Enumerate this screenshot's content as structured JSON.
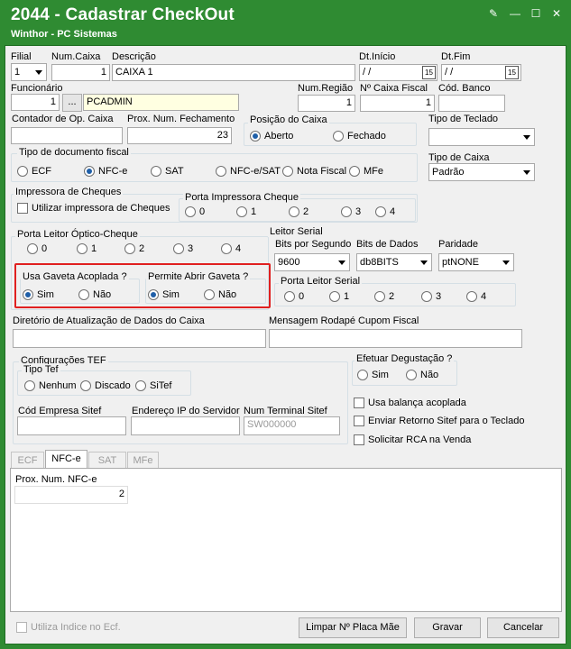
{
  "window": {
    "title": "2044 - Cadastrar CheckOut",
    "subtitle": "Winthor - PC Sistemas",
    "controls": {
      "edit": "✎",
      "minimize": "—",
      "maximize": "☐",
      "close": "✕"
    }
  },
  "fields": {
    "filial": {
      "label": "Filial",
      "value": "1"
    },
    "num_caixa": {
      "label": "Num.Caixa",
      "value": "1"
    },
    "descricao": {
      "label": "Descrição",
      "value": "CAIXA 1"
    },
    "dt_inicio": {
      "label": "Dt.Início",
      "value": " / /"
    },
    "dt_fim": {
      "label": "Dt.Fim",
      "value": " / /"
    },
    "calendar_glyph": "15",
    "funcionario": {
      "label": "Funcionário",
      "code": "1",
      "lookup": "...",
      "name": "PCADMIN"
    },
    "num_regiao": {
      "label": "Num.Região",
      "value": "1"
    },
    "num_caixa_fiscal": {
      "label": "Nº Caixa Fiscal",
      "value": "1"
    },
    "cod_banco": {
      "label": "Cód. Banco",
      "value": ""
    },
    "contador_op": {
      "label": "Contador de Op. Caixa",
      "value": ""
    },
    "prox_num_fechamento": {
      "label": "Prox. Num. Fechamento",
      "value": "23"
    },
    "tipo_teclado": {
      "label": "Tipo de Teclado",
      "value": ""
    },
    "tipo_caixa": {
      "label": "Tipo de Caixa",
      "value": "Padrão"
    },
    "diretorio": {
      "label": "Diretório de Atualização de Dados do Caixa",
      "value": ""
    },
    "mensagem_rodape": {
      "label": "Mensagem Rodapé Cupom Fiscal",
      "value": ""
    }
  },
  "posicao_caixa": {
    "title": "Posição do Caixa",
    "options": [
      "Aberto",
      "Fechado"
    ],
    "selected": "Aberto"
  },
  "tipo_documento": {
    "title": "Tipo de documento fiscal",
    "options": [
      "ECF",
      "NFC-e",
      "SAT",
      "NFC-e/SAT",
      "Nota Fiscal",
      "MFe"
    ],
    "selected": "NFC-e"
  },
  "impressora_cheques": {
    "title": "Impressora de Cheques",
    "checkbox": "Utilizar impressora de Cheques",
    "porta_title": "Porta Impressora Cheque",
    "porta_options": [
      "0",
      "1",
      "2",
      "3",
      "4"
    ]
  },
  "porta_leitor_optico": {
    "title": "Porta Leitor Óptico-Cheque",
    "options": [
      "0",
      "1",
      "2",
      "3",
      "4"
    ]
  },
  "usa_gaveta": {
    "title": "Usa Gaveta Acoplada ?",
    "options": [
      "Sim",
      "Não"
    ],
    "selected": "Sim"
  },
  "permite_gaveta": {
    "title": "Permite Abrir Gaveta ?",
    "options": [
      "Sim",
      "Não"
    ],
    "selected": "Sim"
  },
  "leitor_serial": {
    "title": "Leitor Serial",
    "bits_por_segundo": {
      "label": "Bits por Segundo",
      "value": "9600"
    },
    "bits_de_dados": {
      "label": "Bits de Dados",
      "value": "db8BITS"
    },
    "paridade": {
      "label": "Paridade",
      "value": "ptNONE"
    },
    "porta_title": "Porta Leitor Serial",
    "porta_options": [
      "0",
      "1",
      "2",
      "3",
      "4"
    ]
  },
  "tef": {
    "title": "Configurações TEF",
    "tipo_title": "Tipo Tef",
    "tipo_options": [
      "Nenhum",
      "Discado",
      "SiTef"
    ],
    "cod_empresa": {
      "label": "Cód Empresa Sitef",
      "value": ""
    },
    "endereco_ip": {
      "label": "Endereço IP do Servidor",
      "value": ""
    },
    "num_terminal": {
      "label": "Num Terminal Sitef",
      "value": "SW000000"
    }
  },
  "degustacao": {
    "title": "Efetuar Degustação ?",
    "options": [
      "Sim",
      "Não"
    ]
  },
  "checkboxes": {
    "balanca": "Usa balança acoplada",
    "retorno_sitef": "Enviar Retorno Sitef para o Teclado",
    "solicitar_rca": "Solicitar RCA na Venda"
  },
  "tabs": {
    "items": [
      "ECF",
      "NFC-e",
      "SAT",
      "MFe"
    ],
    "active": "NFC-e"
  },
  "nfce": {
    "label": "Prox. Num. NFC-e",
    "value": "2"
  },
  "footer": {
    "utiliza_indice": "Utiliza Indice no Ecf.",
    "limpar": "Limpar Nº Placa Mãe",
    "gravar": "Gravar",
    "cancelar": "Cancelar"
  }
}
